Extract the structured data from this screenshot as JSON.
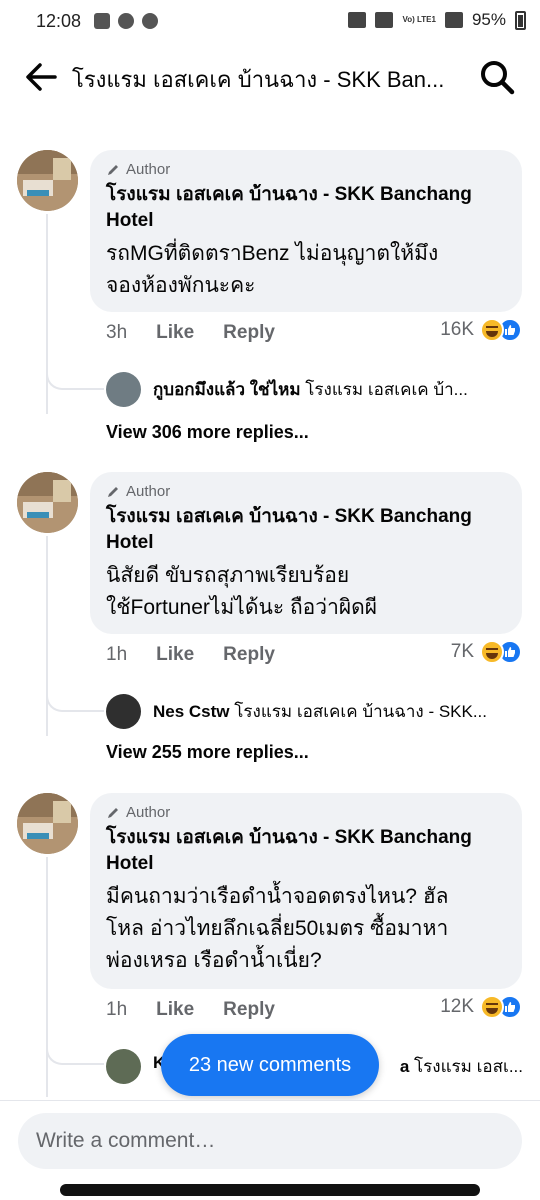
{
  "status": {
    "time": "12:08",
    "battery": "95%",
    "lte": "Vo) LTE1"
  },
  "header": {
    "title": "โรงแรม เอสเคเค บ้านฉาง - SKK Ban..."
  },
  "comments": [
    {
      "author_badge": "Author",
      "name": "โรงแรม เอสเคเค บ้านฉาง - SKK Banchang Hotel",
      "lines": [
        "รถMGที่ติดตราBenz ไม่อนุญาตให้มึง",
        "จองห้องพักนะคะ"
      ],
      "time": "3h",
      "like": "Like",
      "reply": "Reply",
      "reactions": "16K",
      "reply_preview_name": "กูบอกมึงแล้ว ใช่ไหม",
      "reply_preview_text": "โรงแรม เอสเคเค บ้า...",
      "view_more": "View 306 more replies..."
    },
    {
      "author_badge": "Author",
      "name": "โรงแรม เอสเคเค บ้านฉาง - SKK Banchang Hotel",
      "lines": [
        "นิสัยดี ขับรถสุภาพเรียบร้อย",
        "ใช้Fortunerไม่ได้นะ ถือว่าผิดผี"
      ],
      "time": "1h",
      "like": "Like",
      "reply": "Reply",
      "reactions": "7K",
      "reply_preview_name": "Nes Cstw",
      "reply_preview_text": "โรงแรม เอสเคเค บ้านฉาง - SKK...",
      "view_more": "View 255 more replies..."
    },
    {
      "author_badge": "Author",
      "name": "โรงแรม เอสเคเค บ้านฉาง - SKK Banchang Hotel",
      "lines": [
        "มีคนถามว่าเรือดำน้ำจอดตรงไหน? ฮัล",
        "โหล อ่าวไทยลึกเฉลี่ย50เมตร ซื้อมาหา",
        "พ่องเหรอ เรือดำน้ำเนี่ย?"
      ],
      "time": "1h",
      "like": "Like",
      "reply": "Reply",
      "reactions": "12K",
      "reply_preview_name": "K",
      "reply_preview_name_tail": "a",
      "reply_preview_text": "โรงแรม เอสเ..."
    }
  ],
  "new_comments_pill": "23 new comments",
  "composer": {
    "placeholder": "Write a comment…"
  },
  "icons": {
    "back": "arrow-left-icon",
    "search": "search-icon",
    "author": "pencil-icon",
    "reaction1": "haha-icon",
    "reaction2": "like-icon"
  },
  "colors": {
    "accent": "#1877f2",
    "bubble": "#f0f2f5",
    "muted": "#65676b"
  }
}
